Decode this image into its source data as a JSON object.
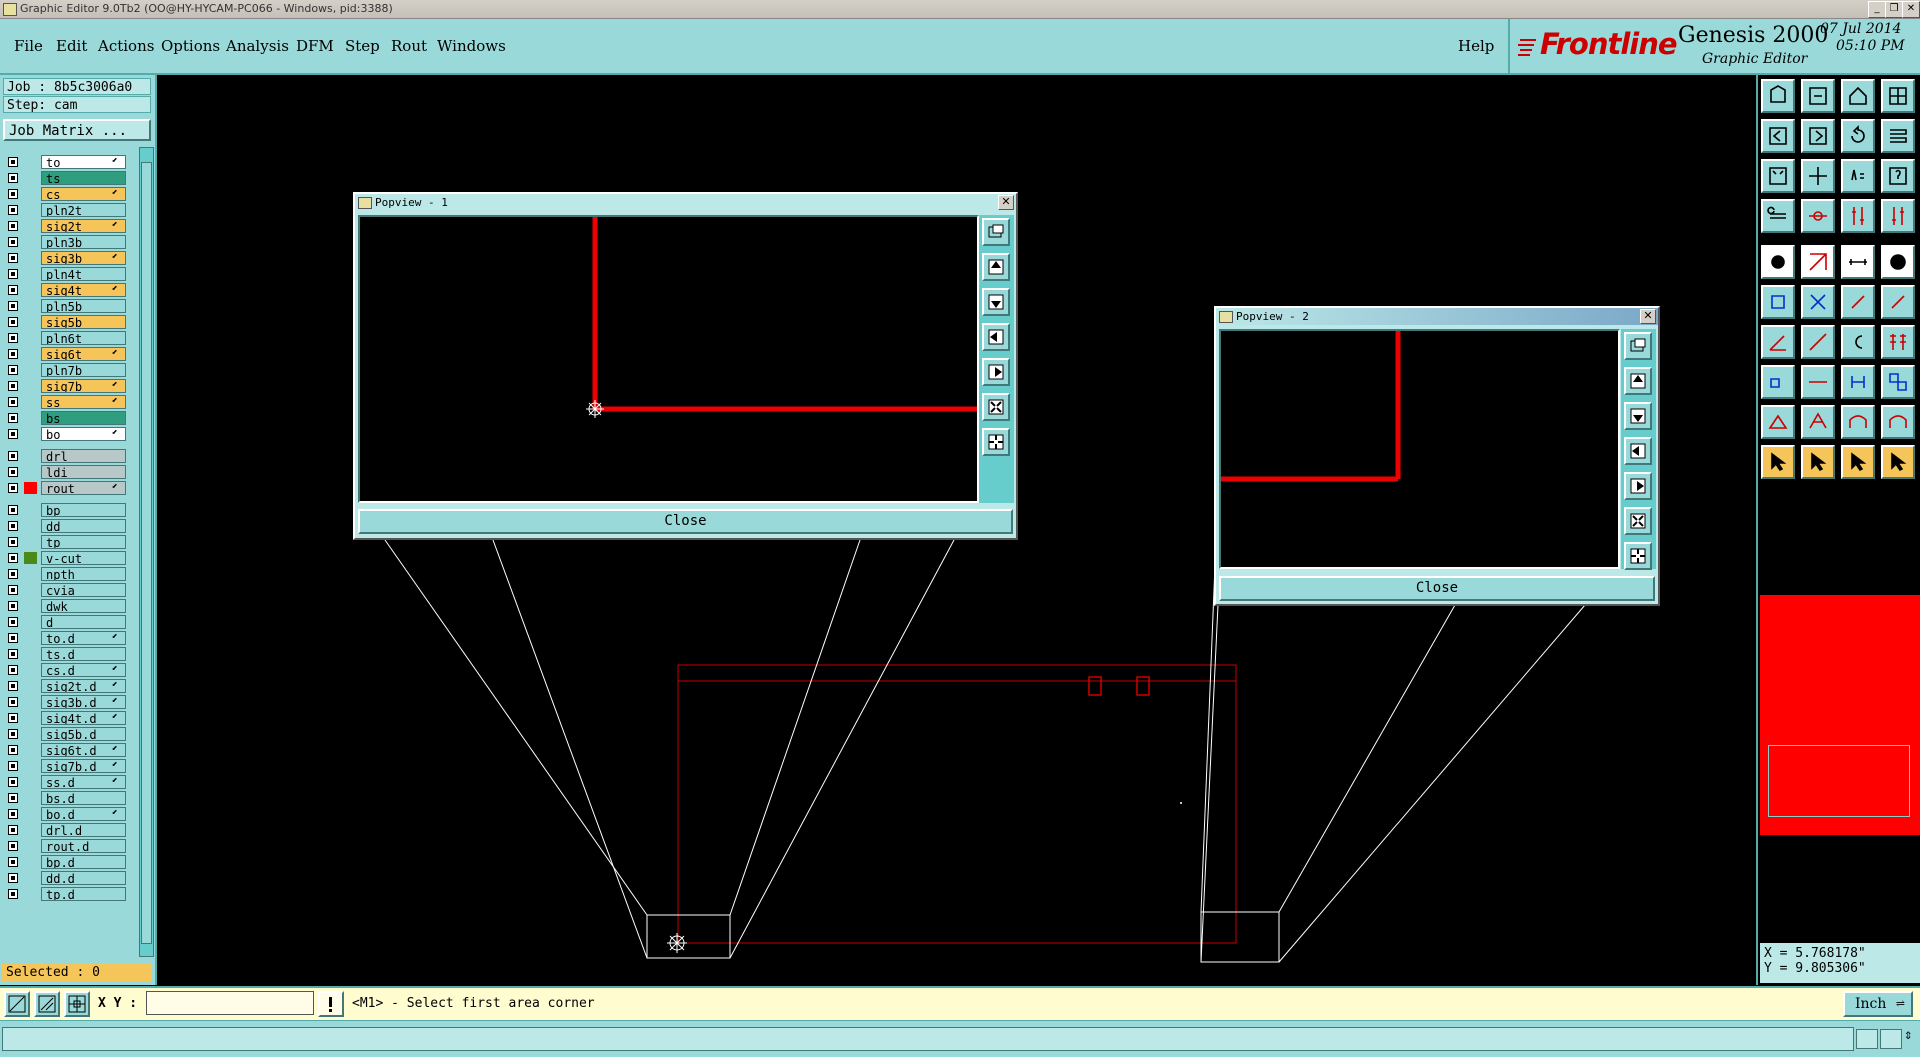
{
  "app": {
    "title": "Graphic Editor 9.0Tb2 (OO@HY-HYCAM-PC066 - Windows, pid:3388)"
  },
  "menu": {
    "items": [
      "File",
      "Edit",
      "Actions",
      "Options",
      "Analysis",
      "DFM",
      "Step",
      "Rout",
      "Windows"
    ],
    "help": "Help"
  },
  "brand": {
    "logo": "Frontline",
    "product": "Genesis 2000",
    "subtitle": "Graphic Editor",
    "date": "07 Jul 2014",
    "time": "05:10 PM"
  },
  "job": {
    "job_line": "Job : 8b5c3006a0",
    "step_line": "Step: cam",
    "matrix_button": "Job Matrix ...",
    "selected": "Selected : 0"
  },
  "layers": [
    {
      "name": "to",
      "bg": "#ffffff",
      "sw": "",
      "edit": true
    },
    {
      "name": "ts",
      "bg": "#2e9e7e",
      "sw": "",
      "edit": false
    },
    {
      "name": "cs",
      "bg": "#f5c55a",
      "sw": "",
      "edit": true
    },
    {
      "name": "pln2t",
      "bg": "#9ad9d9",
      "sw": "",
      "edit": false
    },
    {
      "name": "sig2t",
      "bg": "#f5c55a",
      "sw": "",
      "edit": true
    },
    {
      "name": "pln3b",
      "bg": "#9ad9d9",
      "sw": "",
      "edit": false
    },
    {
      "name": "sig3b",
      "bg": "#f5c55a",
      "sw": "",
      "edit": true
    },
    {
      "name": "pln4t",
      "bg": "#9ad9d9",
      "sw": "",
      "edit": false
    },
    {
      "name": "sig4t",
      "bg": "#f5c55a",
      "sw": "",
      "edit": true
    },
    {
      "name": "pln5b",
      "bg": "#9ad9d9",
      "sw": "",
      "edit": false
    },
    {
      "name": "sig5b",
      "bg": "#f5c55a",
      "sw": "",
      "edit": false
    },
    {
      "name": "pln6t",
      "bg": "#9ad9d9",
      "sw": "",
      "edit": false
    },
    {
      "name": "sig6t",
      "bg": "#f5c55a",
      "sw": "",
      "edit": true
    },
    {
      "name": "pln7b",
      "bg": "#9ad9d9",
      "sw": "",
      "edit": false
    },
    {
      "name": "sig7b",
      "bg": "#f5c55a",
      "sw": "",
      "edit": true
    },
    {
      "name": "ss",
      "bg": "#f5c55a",
      "sw": "",
      "edit": true
    },
    {
      "name": "bs",
      "bg": "#2e9e7e",
      "sw": "",
      "edit": false
    },
    {
      "name": "bo",
      "bg": "#ffffff",
      "sw": "",
      "edit": true
    },
    {
      "name": "drl",
      "bg": "#b8c8c8",
      "sw": "",
      "edit": false
    },
    {
      "name": "ldi",
      "bg": "#b8c8c8",
      "sw": "",
      "edit": false
    },
    {
      "name": "rout",
      "bg": "#b8c8c8",
      "sw": "#ff0000",
      "edit": true
    },
    {
      "name": "bp",
      "bg": "#9ad9d9",
      "sw": "",
      "edit": false
    },
    {
      "name": "dd",
      "bg": "#9ad9d9",
      "sw": "",
      "edit": false
    },
    {
      "name": "tp",
      "bg": "#9ad9d9",
      "sw": "",
      "edit": false
    },
    {
      "name": "v-cut",
      "bg": "#9ad9d9",
      "sw": "#4a8a1a",
      "edit": false
    },
    {
      "name": "npth",
      "bg": "#9ad9d9",
      "sw": "",
      "edit": false
    },
    {
      "name": "cvia",
      "bg": "#9ad9d9",
      "sw": "",
      "edit": false
    },
    {
      "name": "dwk",
      "bg": "#9ad9d9",
      "sw": "",
      "edit": false
    },
    {
      "name": "d",
      "bg": "#9ad9d9",
      "sw": "",
      "edit": false
    },
    {
      "name": "to.d",
      "bg": "#9ad9d9",
      "sw": "",
      "edit": true
    },
    {
      "name": "ts.d",
      "bg": "#9ad9d9",
      "sw": "",
      "edit": false
    },
    {
      "name": "cs.d",
      "bg": "#9ad9d9",
      "sw": "",
      "edit": true
    },
    {
      "name": "sig2t.d",
      "bg": "#9ad9d9",
      "sw": "",
      "edit": true
    },
    {
      "name": "sig3b.d",
      "bg": "#9ad9d9",
      "sw": "",
      "edit": true
    },
    {
      "name": "sig4t.d",
      "bg": "#9ad9d9",
      "sw": "",
      "edit": true
    },
    {
      "name": "sig5b.d",
      "bg": "#9ad9d9",
      "sw": "",
      "edit": false
    },
    {
      "name": "sig6t.d",
      "bg": "#9ad9d9",
      "sw": "",
      "edit": true
    },
    {
      "name": "sig7b.d",
      "bg": "#9ad9d9",
      "sw": "",
      "edit": true
    },
    {
      "name": "ss.d",
      "bg": "#9ad9d9",
      "sw": "",
      "edit": true
    },
    {
      "name": "bs.d",
      "bg": "#9ad9d9",
      "sw": "",
      "edit": false
    },
    {
      "name": "bo.d",
      "bg": "#9ad9d9",
      "sw": "",
      "edit": true
    },
    {
      "name": "drl.d",
      "bg": "#9ad9d9",
      "sw": "",
      "edit": false
    },
    {
      "name": "rout.d",
      "bg": "#9ad9d9",
      "sw": "",
      "edit": false
    },
    {
      "name": "bp.d",
      "bg": "#9ad9d9",
      "sw": "",
      "edit": false
    },
    {
      "name": "dd.d",
      "bg": "#9ad9d9",
      "sw": "",
      "edit": false
    },
    {
      "name": "tp.d",
      "bg": "#9ad9d9",
      "sw": "",
      "edit": false
    }
  ],
  "popviews": [
    {
      "title": "Popview - 1",
      "close_label": "Close"
    },
    {
      "title": "Popview - 2",
      "close_label": "Close"
    }
  ],
  "coords": {
    "x": "X = 5.768178\"",
    "y": "Y = 9.805306\""
  },
  "cmdbar": {
    "xy_label": "X Y :",
    "xy_value": "",
    "prompt": "<M1> - Select first area corner",
    "unit": "Inch"
  },
  "colors": {
    "panel": "#9ad9d9",
    "accent_red": "#ff0000",
    "signal_layer": "#f5c55a"
  }
}
